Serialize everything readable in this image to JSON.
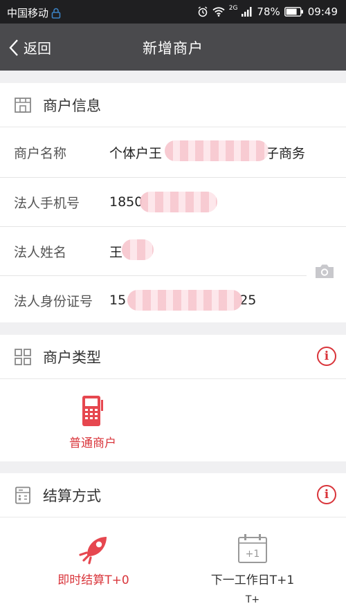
{
  "status_bar": {
    "carrier": "中国移动",
    "network": "2G",
    "battery": "78%",
    "time": "09:49"
  },
  "nav": {
    "back_label": "返回",
    "title": "新增商户"
  },
  "merchant_info": {
    "title": "商户信息",
    "rows": [
      {
        "label": "商户名称",
        "value_start": "个体户王",
        "value_end": "子商务"
      },
      {
        "label": "法人手机号",
        "value_start": "1850",
        "value_end": ""
      },
      {
        "label": "法人姓名",
        "value_start": "王",
        "value_end": ""
      },
      {
        "label": "法人身份证号",
        "value_start": "15",
        "value_end": "25"
      }
    ]
  },
  "merchant_type": {
    "title": "商户类型",
    "options": [
      {
        "label": "普通商户",
        "selected": true
      }
    ]
  },
  "settlement": {
    "title": "结算方式",
    "options": [
      {
        "label": "即时结算T+0",
        "selected": true
      },
      {
        "label": "下一工作日T+1",
        "selected": false
      }
    ],
    "calendar_badge": "+1",
    "cut_off_text": "T+"
  },
  "colors": {
    "accent": "#d9343a",
    "navbar": "#4a4a4d",
    "statusbar": "#1f1f21"
  }
}
